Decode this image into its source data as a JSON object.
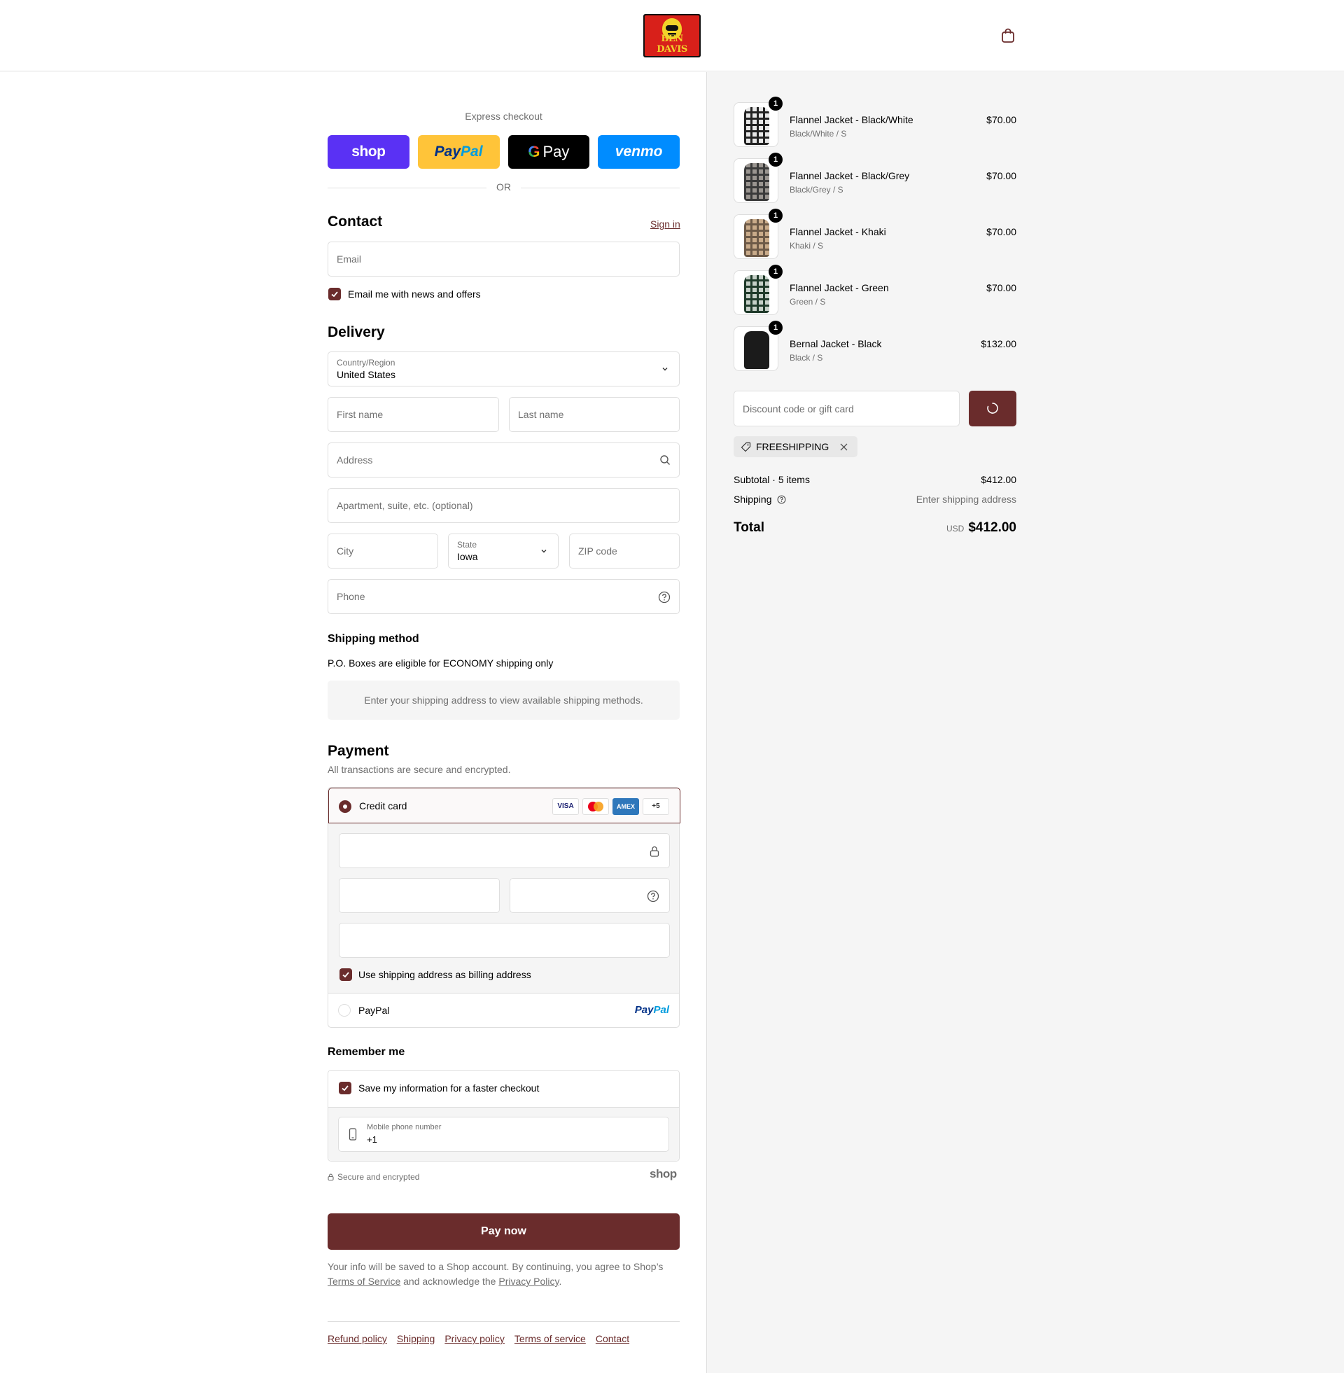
{
  "header": {
    "logo_text": "BEN DAVIS",
    "cart_icon": "shopping-bag-icon"
  },
  "express": {
    "label": "Express checkout",
    "shop": "shop",
    "paypal_a": "Pay",
    "paypal_b": "Pal",
    "gpay": "Pay",
    "venmo": "venmo",
    "or": "OR"
  },
  "contact": {
    "title": "Contact",
    "sign_in": "Sign in",
    "email_placeholder": "Email",
    "news_label": "Email me with news and offers",
    "news_checked": true
  },
  "delivery": {
    "title": "Delivery",
    "country_label": "Country/Region",
    "country_value": "United States",
    "first_name": "First name",
    "last_name": "Last name",
    "address": "Address",
    "apartment": "Apartment, suite, etc. (optional)",
    "city": "City",
    "state_label": "State",
    "state_value": "Iowa",
    "zip": "ZIP code",
    "phone": "Phone"
  },
  "shipping_method": {
    "title": "Shipping method",
    "note": "P.O. Boxes are eligible for ECONOMY shipping only",
    "placeholder": "Enter your shipping address to view available shipping methods."
  },
  "payment": {
    "title": "Payment",
    "subtitle": "All transactions are secure and encrypted.",
    "credit_card": "Credit card",
    "cards": [
      "VISA",
      "",
      "AMEX",
      "+5"
    ],
    "billing_label": "Use shipping address as billing address",
    "billing_checked": true,
    "paypal_label": "PayPal",
    "paypal_logo_a": "Pay",
    "paypal_logo_b": "Pal"
  },
  "remember": {
    "title": "Remember me",
    "save_label": "Save my information for a faster checkout",
    "save_checked": true,
    "mobile_label": "Mobile phone number",
    "mobile_value": "+1",
    "secure": "Secure and encrypted",
    "shop_logo": "shop"
  },
  "pay_now": "Pay now",
  "legal": {
    "text1": "Your info will be saved to a Shop account. By continuing, you agree to Shop’s",
    "tos": "Terms of Service",
    "text2": "and acknowledge the",
    "privacy": "Privacy Policy",
    "text3": "."
  },
  "footer": [
    "Refund policy",
    "Shipping",
    "Privacy policy",
    "Terms of service",
    "Contact"
  ],
  "cart": {
    "items": [
      {
        "name": "Flannel Jacket - Black/White",
        "variant": "Black/White / S",
        "price": "$70.00",
        "qty": "1",
        "color": "#e8e8e8",
        "stripe": "#222"
      },
      {
        "name": "Flannel Jacket - Black/Grey",
        "variant": "Black/Grey / S",
        "price": "$70.00",
        "qty": "1",
        "color": "#9a9590",
        "stripe": "#3a3a3a"
      },
      {
        "name": "Flannel Jacket - Khaki",
        "variant": "Khaki / S",
        "price": "$70.00",
        "qty": "1",
        "color": "#c9ab8a",
        "stripe": "#6d5a48"
      },
      {
        "name": "Flannel Jacket - Green",
        "variant": "Green / S",
        "price": "$70.00",
        "qty": "1",
        "color": "#c6d0c8",
        "stripe": "#1f3a2a"
      },
      {
        "name": "Bernal Jacket - Black",
        "variant": "Black / S",
        "price": "$132.00",
        "qty": "1",
        "color": "#1b1b1b",
        "stripe": "#1b1b1b"
      }
    ],
    "discount_placeholder": "Discount code or gift card",
    "applied_code": "FREESHIPPING",
    "subtotal_label": "Subtotal · 5 items",
    "subtotal_value": "$412.00",
    "shipping_label": "Shipping",
    "shipping_value": "Enter shipping address",
    "total_label": "Total",
    "currency": "USD",
    "total_value": "$412.00"
  },
  "colors": {
    "accent": "#6a2c2c",
    "border": "#dedede",
    "muted": "#707070",
    "sidebar_bg": "#f5f5f5"
  }
}
